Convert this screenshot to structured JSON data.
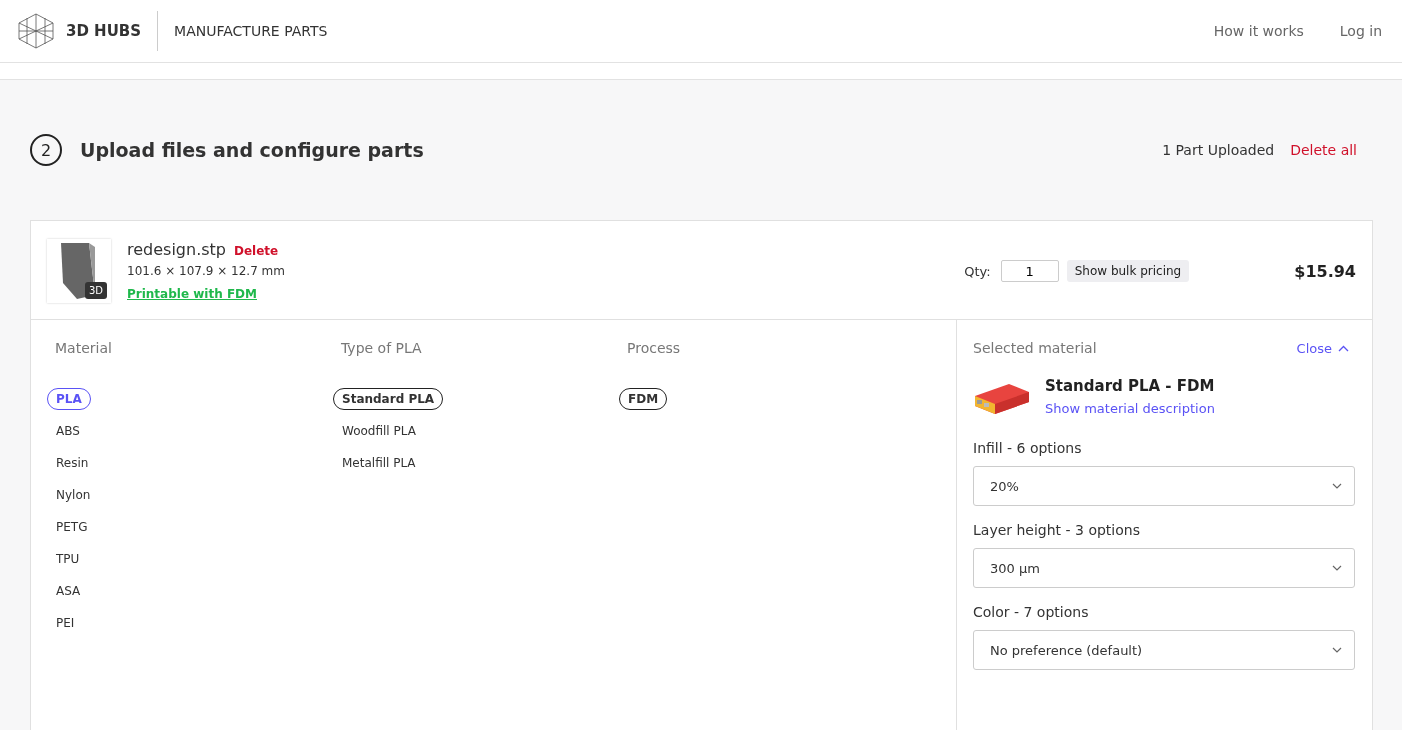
{
  "header": {
    "brand": "3D HUBS",
    "section": "MANUFACTURE PARTS",
    "nav": [
      "How it works",
      "Log in"
    ]
  },
  "step": {
    "number": "2",
    "title": "Upload files and configure parts",
    "count": "1 Part Uploaded",
    "delete_all": "Delete all"
  },
  "part": {
    "name": "redesign.stp",
    "delete": "Delete",
    "dimensions": "101.6 × 107.9 × 12.7 mm",
    "printable": "Printable with FDM",
    "badge": "3D",
    "qty_label": "Qty:",
    "qty": "1",
    "bulk": "Show bulk pricing",
    "price": "$15.94"
  },
  "columns": [
    {
      "heading": "Material",
      "options": [
        {
          "label": "PLA",
          "selected": true
        },
        {
          "label": "ABS",
          "selected": false
        },
        {
          "label": "Resin",
          "selected": false
        },
        {
          "label": "Nylon",
          "selected": false
        },
        {
          "label": "PETG",
          "selected": false
        },
        {
          "label": "TPU",
          "selected": false
        },
        {
          "label": "ASA",
          "selected": false
        },
        {
          "label": "PEI",
          "selected": false
        }
      ]
    },
    {
      "heading": "Type of PLA",
      "options": [
        {
          "label": "Standard PLA",
          "selected": true
        },
        {
          "label": "Woodfill PLA",
          "selected": false
        },
        {
          "label": "Metalfill PLA",
          "selected": false
        }
      ]
    },
    {
      "heading": "Process",
      "options": [
        {
          "label": "FDM",
          "selected": true
        }
      ]
    }
  ],
  "selected_material": {
    "heading": "Selected material",
    "close": "Close",
    "name": "Standard PLA - FDM",
    "description_link": "Show material description",
    "settings": [
      {
        "label": "Infill - 6 options",
        "value": "20%"
      },
      {
        "label": "Layer height - 3 options",
        "value": "300 µm"
      },
      {
        "label": "Color - 7 options",
        "value": "No preference (default)"
      }
    ]
  }
}
